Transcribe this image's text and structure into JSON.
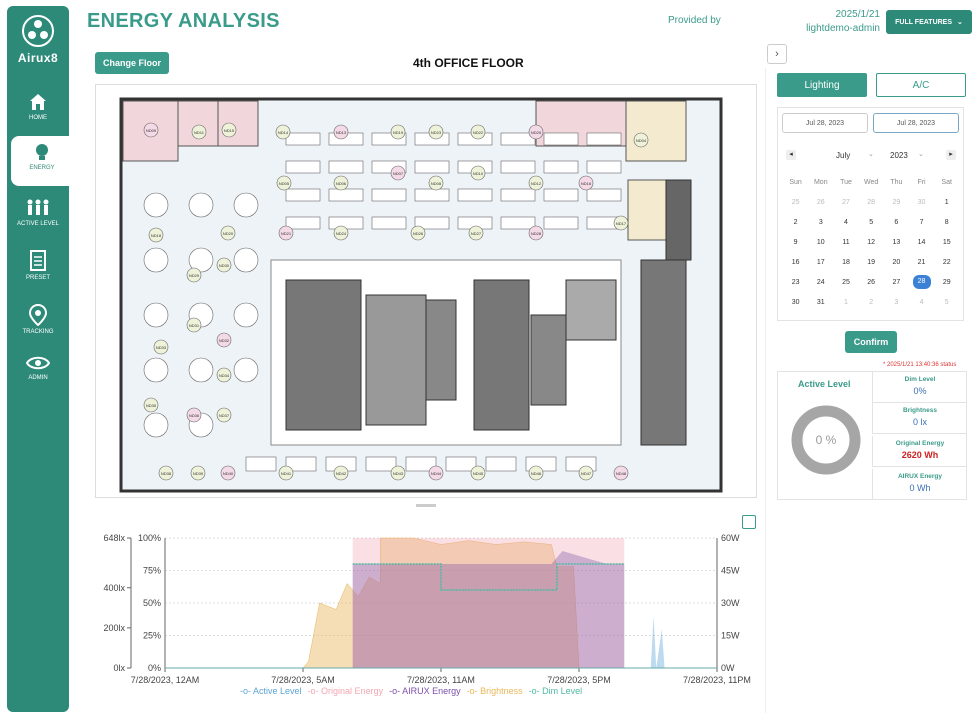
{
  "sidebar": {
    "brand": "Airux8",
    "items": [
      {
        "label": "HOME",
        "icon": "home-icon"
      },
      {
        "label": "ENERGY",
        "icon": "lightbulb-icon",
        "active": true
      },
      {
        "label": "ACTIVE LEVEL",
        "icon": "people-icon"
      },
      {
        "label": "PRESET",
        "icon": "document-icon"
      },
      {
        "label": "TRACKING",
        "icon": "location-pin-icon"
      },
      {
        "label": "ADMIN",
        "icon": "eye-icon"
      }
    ]
  },
  "header": {
    "title": "ENERGY ANALYSIS",
    "provided_by": "Provided by",
    "date": "2025/1/21",
    "user": "lightdemo-admin",
    "full_features": "FULL FEATURES"
  },
  "floor": {
    "change_floor": "Change Floor",
    "title": "4th OFFICE FLOOR",
    "node_labels": [
      "ND09",
      "ND11",
      "ND15",
      "ND14",
      "ND13",
      "ND19",
      "ND23",
      "ND22",
      "ND25",
      "ND04",
      "ND05",
      "ND06",
      "ND07",
      "ND08",
      "ND10",
      "ND12",
      "ND16",
      "ND17",
      "ND18",
      "ND20",
      "ND21",
      "ND24",
      "ND26",
      "ND27",
      "ND28",
      "ND29",
      "ND30",
      "ND31",
      "ND32",
      "ND33",
      "ND34",
      "ND35",
      "ND36",
      "ND37",
      "ND38",
      "ND39",
      "ND40",
      "ND41",
      "ND42",
      "ND43",
      "ND44",
      "ND45",
      "ND46",
      "ND47",
      "ND48"
    ]
  },
  "chart_data": {
    "type": "area",
    "x": [
      "7/28/2023, 12AM",
      "7/28/2023, 5AM",
      "7/28/2023, 11AM",
      "7/28/2023, 5PM",
      "7/28/2023, 11PM"
    ],
    "left_axis_percent": [
      "0%",
      "25%",
      "50%",
      "75%",
      "100%"
    ],
    "left_axis_lux": [
      "0lx",
      "200lx",
      "400lx",
      "648lx"
    ],
    "right_axis": [
      "0W",
      "15W",
      "30W",
      "45W",
      "60W"
    ],
    "series": [
      {
        "name": "Active Level",
        "color": "#5ba5d6"
      },
      {
        "name": "Original Energy",
        "color": "#f2a7b1"
      },
      {
        "name": "AIRUX Energy",
        "color": "#7b4fa8"
      },
      {
        "name": "Brightness",
        "color": "#e8b65a"
      },
      {
        "name": "Dim Level",
        "color": "#4fb8a3"
      }
    ]
  },
  "panel": {
    "tabs": [
      "Lighting",
      "A/C"
    ],
    "date_from": "Jul 28, 2023",
    "date_to": "Jul 28, 2023",
    "month": "July",
    "year": "2023",
    "weekdays": [
      "Sun",
      "Mon",
      "Tue",
      "Wed",
      "Thu",
      "Fri",
      "Sat"
    ],
    "weeks": [
      [
        "25",
        "26",
        "27",
        "28",
        "29",
        "30",
        "1"
      ],
      [
        "2",
        "3",
        "4",
        "5",
        "6",
        "7",
        "8"
      ],
      [
        "9",
        "10",
        "11",
        "12",
        "13",
        "14",
        "15"
      ],
      [
        "16",
        "17",
        "18",
        "19",
        "20",
        "21",
        "22"
      ],
      [
        "23",
        "24",
        "25",
        "26",
        "27",
        "28",
        "29"
      ],
      [
        "30",
        "31",
        "1",
        "2",
        "3",
        "4",
        "5"
      ]
    ],
    "confirm": "Confirm",
    "status": "* 2025/1/21 13:40:36 status",
    "active_level_title": "Active Level",
    "active_level_value": "0 %",
    "stats": [
      {
        "label": "Dim Level",
        "value": "0%"
      },
      {
        "label": "Brightness",
        "value": "0 lx"
      },
      {
        "label": "Original Energy",
        "value": "2620 Wh"
      },
      {
        "label": "AIRUX Energy",
        "value": "0 Wh"
      }
    ]
  }
}
